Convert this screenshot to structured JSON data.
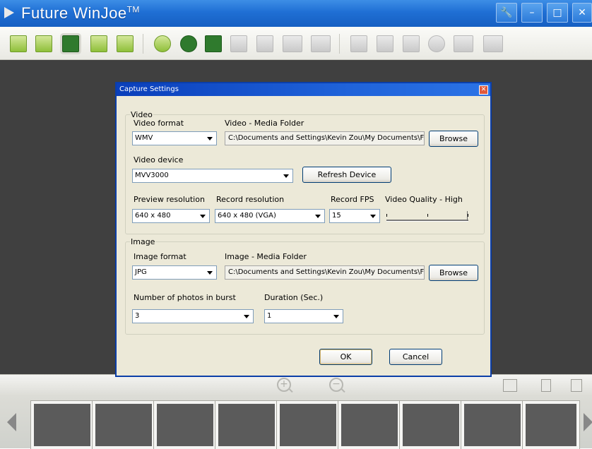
{
  "app": {
    "title": "Future WinJoe",
    "trademark": "TM"
  },
  "window_controls": {
    "settings": "🔧",
    "minimize": "–",
    "maximize": "□",
    "close": "✕"
  },
  "dialog": {
    "title": "Capture Settings",
    "close_glyph": "✕",
    "video": {
      "group_label": "Video",
      "format_label": "Video format",
      "format_value": "WMV",
      "folder_label": "Video - Media Folder",
      "folder_path": "C:\\Documents and Settings\\Kevin Zou\\My Documents\\F",
      "browse_label": "Browse",
      "device_label": "Video device",
      "device_value": "MVV3000",
      "refresh_label": "Refresh Device",
      "preview_res_label": "Preview resolution",
      "preview_res_value": "640 x 480",
      "record_res_label": "Record resolution",
      "record_res_value": "640 x 480 (VGA)",
      "fps_label": "Record FPS",
      "fps_value": "15",
      "quality_label": "Video Quality - High",
      "quality_level": 1.0
    },
    "image": {
      "group_label": "Image",
      "format_label": "Image format",
      "format_value": "JPG",
      "folder_label": "Image - Media Folder",
      "folder_path": "C:\\Documents and Settings\\Kevin Zou\\My Documents\\F",
      "browse_label": "Browse",
      "burst_label": "Number of photos in burst",
      "burst_value": "3",
      "duration_label": "Duration (Sec.)",
      "duration_value": "1"
    },
    "ok_label": "OK",
    "cancel_label": "Cancel"
  },
  "bottom": {
    "zoom_in": "+",
    "zoom_out": "−"
  }
}
